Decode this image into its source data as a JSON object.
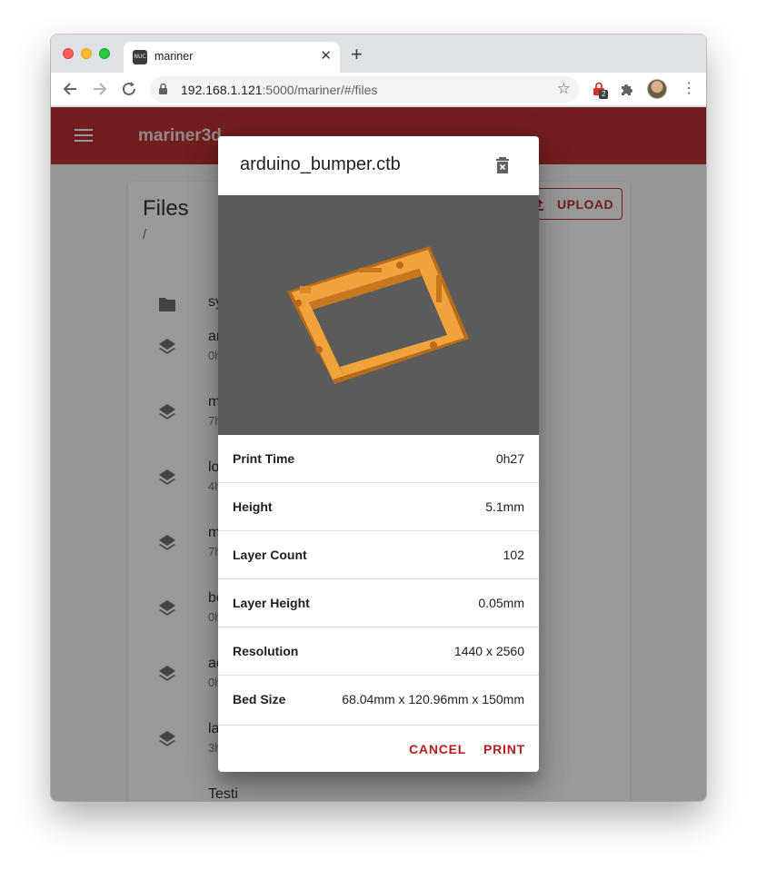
{
  "browser": {
    "tab_title": "mariner",
    "favicon_text": "NUC",
    "url_host": "192.168.1.121",
    "url_path": ":5000/mariner/#/files",
    "extension_badge": "2"
  },
  "app": {
    "title": "mariner3d",
    "header_color": "#b71c1c"
  },
  "files": {
    "title": "Files",
    "path": "/",
    "upload_label": "UPLOAD",
    "items": [
      {
        "name": "sy",
        "meta": "",
        "icon": "folder-icon"
      },
      {
        "name": "ar",
        "meta": "0h",
        "icon": "layers-icon"
      },
      {
        "name": "m",
        "meta": "7h",
        "icon": "layers-icon"
      },
      {
        "name": "lo",
        "meta": "4h",
        "icon": "layers-icon"
      },
      {
        "name": "m",
        "meta": "7h",
        "icon": "layers-icon"
      },
      {
        "name": "be",
        "meta": "0h",
        "icon": "layers-icon"
      },
      {
        "name": "ac",
        "meta": "0h",
        "icon": "layers-icon"
      },
      {
        "name": "la",
        "meta": "3h",
        "icon": "layers-icon"
      },
      {
        "name": "Testi",
        "meta": "",
        "icon": "layers-icon"
      }
    ]
  },
  "dialog": {
    "title": "arduino_bumper.ctb",
    "properties": [
      {
        "label": "Print Time",
        "value": "0h27"
      },
      {
        "label": "Height",
        "value": "5.1mm"
      },
      {
        "label": "Layer Count",
        "value": "102"
      },
      {
        "label": "Layer Height",
        "value": "0.05mm"
      },
      {
        "label": "Resolution",
        "value": "1440 x 2560"
      },
      {
        "label": "Bed Size",
        "value": "68.04mm x 120.96mm x 150mm"
      }
    ],
    "cancel_label": "CANCEL",
    "print_label": "PRINT",
    "accent": "#b71c1c",
    "model_color": "#e8902a"
  }
}
